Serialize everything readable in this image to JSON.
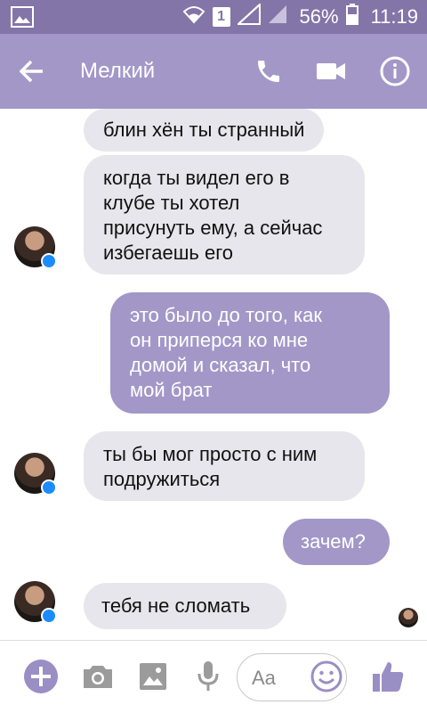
{
  "status_bar": {
    "sim_label": "1",
    "battery": "56%",
    "time": "11:19"
  },
  "header": {
    "contact_name": "Мелкий"
  },
  "messages": [
    {
      "side": "in",
      "text": "блин хён ты странный"
    },
    {
      "side": "in",
      "text": "когда ты видел его в\nклубе ты хотел\nприсунуть ему, а сейчас\nизбегаешь его"
    },
    {
      "side": "out",
      "text": "это было до того, как\nон приперся ко мне\nдомой и сказал, что\nмой брат"
    },
    {
      "side": "in",
      "text": "ты бы мог просто с ним\nподружиться"
    },
    {
      "side": "out",
      "text": "зачем?"
    },
    {
      "side": "in",
      "text": "тебя не сломать"
    }
  ],
  "composer": {
    "placeholder": "Aa"
  },
  "colors": {
    "status_bar": "#8475a8",
    "header": "#a397c8",
    "outgoing_bubble": "#a397c8",
    "incoming_bubble": "#e6e6ec",
    "accent_icon": "#9a8fc4"
  },
  "icons": [
    "gallery-notification-icon",
    "wifi-icon",
    "no-signal-icon",
    "battery-icon",
    "back-arrow-icon",
    "phone-icon",
    "video-camera-icon",
    "info-icon",
    "plus-icon",
    "camera-icon",
    "image-icon",
    "microphone-icon",
    "emoji-icon",
    "thumbs-up-icon"
  ]
}
